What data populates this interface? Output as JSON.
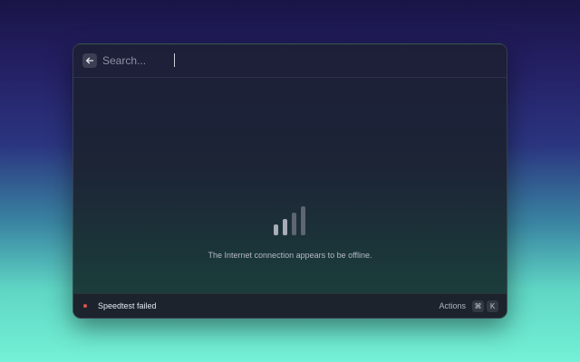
{
  "search": {
    "placeholder": "Search...",
    "value": ""
  },
  "main": {
    "icon": "signal-bars-icon",
    "message": "The Internet connection appears to be offline."
  },
  "footer": {
    "status_text": "Speedtest failed",
    "status_color": "#e0524a",
    "actions_label": "Actions",
    "shortcut_cmd": "⌘",
    "shortcut_key": "K"
  }
}
